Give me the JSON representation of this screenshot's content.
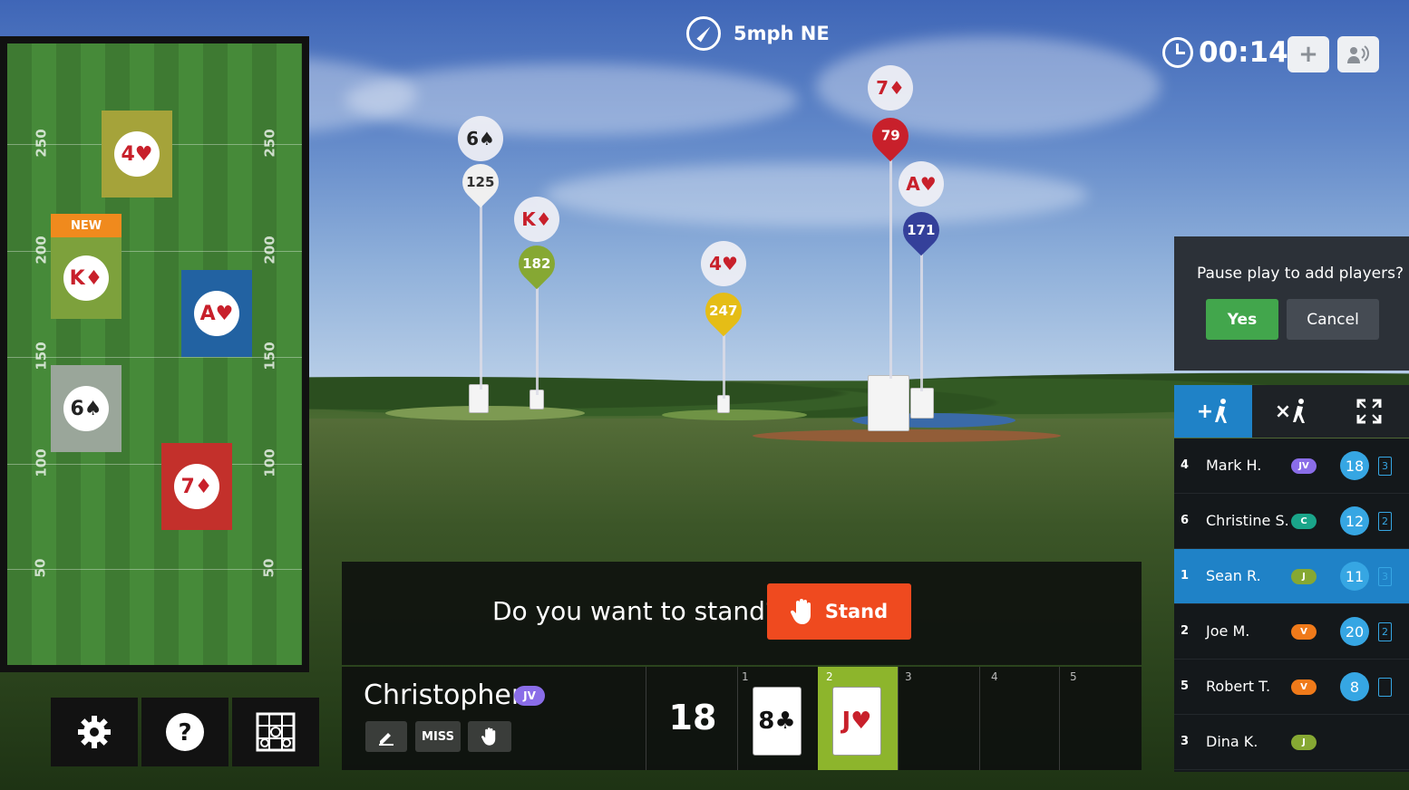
{
  "wind": {
    "label": "5mph NE",
    "icon": "compass-icon"
  },
  "timer": {
    "value": "00:14",
    "icon": "clock-icon"
  },
  "top_buttons": [
    {
      "name": "add-button",
      "label": "+"
    },
    {
      "name": "broadcast-button",
      "icon": "broadcast-icon"
    }
  ],
  "pins": [
    {
      "card": "6♠",
      "card_color": "#222222",
      "distance": "125",
      "pin_color": "#f0f0f0",
      "text_color": "#333333"
    },
    {
      "card": "K♦",
      "card_color": "#c8202b",
      "distance": "182",
      "pin_color": "#86a833",
      "text_color": "#ffffff"
    },
    {
      "card": "4♥",
      "card_color": "#c8202b",
      "distance": "247",
      "pin_color": "#e5bd16",
      "text_color": "#ffffff"
    },
    {
      "card": "7♦",
      "card_color": "#c8202b",
      "distance": "79",
      "pin_color": "#c8202b",
      "text_color": "#ffffff"
    },
    {
      "card": "A♥",
      "card_color": "#c8202b",
      "distance": "171",
      "pin_color": "#34409a",
      "text_color": "#ffffff"
    }
  ],
  "map": {
    "yard_labels": [
      "250",
      "200",
      "150",
      "100",
      "50"
    ],
    "new_tag": "NEW",
    "zones": [
      {
        "card": "4♥",
        "color": "#c8202b",
        "bg": "#a5a33a"
      },
      {
        "card": "K♦",
        "color": "#c8202b",
        "bg": "#7da13c"
      },
      {
        "card": "A♥",
        "color": "#c8202b",
        "bg": "#2262a2"
      },
      {
        "card": "6♠",
        "color": "#222222",
        "bg": "#9aa69a"
      },
      {
        "card": "7♦",
        "color": "#c8202b",
        "bg": "#c3302b"
      }
    ]
  },
  "tools": [
    {
      "name": "settings-button",
      "icon": "gear-icon"
    },
    {
      "name": "help-button",
      "icon": "question-icon"
    },
    {
      "name": "grid-button",
      "icon": "target-grid-icon"
    }
  ],
  "stand": {
    "question": "Do you want to stand?",
    "button_label": "Stand",
    "icon": "hand-icon"
  },
  "player": {
    "name": "Christopher",
    "badge": "JV",
    "score": "18",
    "actions": [
      {
        "name": "edit-button",
        "icon": "pencil-icon"
      },
      {
        "name": "miss-button",
        "label": "MISS"
      },
      {
        "name": "stand-small-button",
        "icon": "hand-icon"
      }
    ],
    "slots": [
      "1",
      "2",
      "3",
      "4",
      "5"
    ],
    "hand": [
      {
        "rank": "8",
        "suit": "♣",
        "color": "#111111"
      },
      {
        "rank": "J",
        "suit": "♥",
        "color": "#c8202b"
      }
    ]
  },
  "dialog": {
    "question": "Pause play to add players?",
    "yes": "Yes",
    "cancel": "Cancel"
  },
  "roster_tabs": [
    {
      "name": "tab-add-player",
      "icon": "add-golfer-icon",
      "label": "+"
    },
    {
      "name": "tab-remove-player",
      "icon": "remove-golfer-icon",
      "label": "×"
    },
    {
      "name": "tab-fullscreen",
      "icon": "fullscreen-icon"
    }
  ],
  "roster": [
    {
      "idx": "4",
      "name": "Mark H.",
      "badge": "JV",
      "badge_color": "#8a6de8",
      "score": "18",
      "cards": "3"
    },
    {
      "idx": "6",
      "name": "Christine S.",
      "badge": "C",
      "badge_color": "#1aa58a",
      "score": "12",
      "cards": "2"
    },
    {
      "idx": "1",
      "name": "Sean R.",
      "badge": "J",
      "badge_color": "#86a833",
      "score": "11",
      "cards": "3"
    },
    {
      "idx": "2",
      "name": "Joe M.",
      "badge": "V",
      "badge_color": "#f07a1a",
      "score": "20",
      "cards": "2"
    },
    {
      "idx": "5",
      "name": "Robert T.",
      "badge": "V",
      "badge_color": "#f07a1a",
      "score": "8",
      "cards": ""
    },
    {
      "idx": "3",
      "name": "Dina K.",
      "badge": "J",
      "badge_color": "#86a833",
      "score": "",
      "cards": ""
    }
  ]
}
